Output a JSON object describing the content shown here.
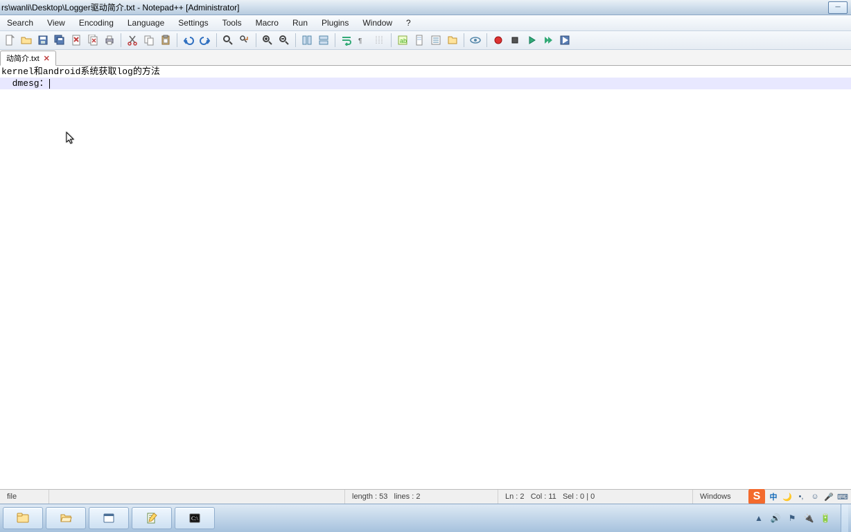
{
  "titlebar": {
    "title": "rs\\wanli\\Desktop\\Logger驱动简介.txt - Notepad++ [Administrator]"
  },
  "menu": [
    "Search",
    "View",
    "Encoding",
    "Language",
    "Settings",
    "Tools",
    "Macro",
    "Run",
    "Plugins",
    "Window",
    "?"
  ],
  "toolbar_icons": [
    "new-file-icon",
    "open-file-icon",
    "save-file-icon",
    "save-all-icon",
    "close-icon",
    "close-all-icon",
    "print-icon",
    "__sep",
    "cut-icon",
    "copy-icon",
    "paste-icon",
    "__sep",
    "undo-icon",
    "redo-icon",
    "__sep",
    "find-icon",
    "replace-icon",
    "__sep",
    "zoom-in-icon",
    "zoom-out-icon",
    "__sep",
    "sync-vert-icon",
    "sync-horiz-icon",
    "__sep",
    "word-wrap-icon",
    "show-all-icon",
    "indent-guide-icon",
    "__sep",
    "language-icon",
    "doc-map-icon",
    "func-list-icon",
    "folder-tree-icon",
    "__sep",
    "monitor-icon",
    "__sep",
    "record-macro-icon",
    "stop-macro-icon",
    "play-macro-icon",
    "play-multi-icon",
    "save-macro-icon"
  ],
  "tab": {
    "label": "动简介.txt",
    "close": "✕"
  },
  "editor": {
    "lines": [
      "kernel和android系统获取log的方法",
      "  dmesg："
    ],
    "current_line_index": 1
  },
  "status": {
    "left": "file",
    "length": "length : 53",
    "lines": "lines : 2",
    "ln": "Ln : 2",
    "col": "Col : 11",
    "sel": "Sel : 0 | 0",
    "encoding": "Windows"
  },
  "tray": {
    "sogou_letter": "S",
    "ime_lang": "中",
    "moon": "🌙",
    "dots": "•,",
    "smile": "☺",
    "mic": "🎤",
    "keyboard": "⌨",
    "arrow_up": "▲",
    "speaker": "🔊",
    "flag": "⚑",
    "plug": "🔌",
    "battery": "🔋"
  }
}
